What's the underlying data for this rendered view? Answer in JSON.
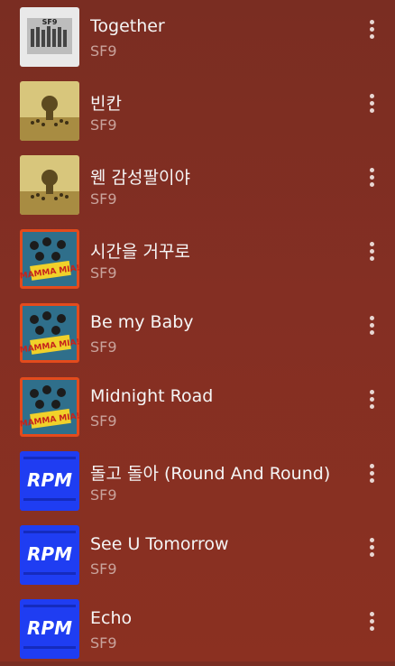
{
  "songs": [
    {
      "title": "Together",
      "artist": "SF9",
      "art": "album-sf9",
      "art_text": "SF9"
    },
    {
      "title": "빈칸",
      "artist": "SF9",
      "art": "album-gold",
      "art_text": ""
    },
    {
      "title": "웬 감성팔이야",
      "artist": "SF9",
      "art": "album-gold",
      "art_text": ""
    },
    {
      "title": "시간을 거꾸로",
      "artist": "SF9",
      "art": "album-mamma",
      "art_text": "MAMMA MIA!"
    },
    {
      "title": "Be my Baby",
      "artist": "SF9",
      "art": "album-mamma",
      "art_text": "MAMMA MIA!"
    },
    {
      "title": "Midnight Road",
      "artist": "SF9",
      "art": "album-mamma",
      "art_text": "MAMMA MIA!"
    },
    {
      "title": "돌고 돌아 (Round And Round)",
      "artist": "SF9",
      "art": "album-rpm",
      "art_text": "RPM"
    },
    {
      "title": "See U Tomorrow",
      "artist": "SF9",
      "art": "album-rpm",
      "art_text": "RPM"
    },
    {
      "title": "Echo",
      "artist": "SF9",
      "art": "album-rpm",
      "art_text": "RPM"
    }
  ],
  "colors": {
    "background_top": "#7a2d22",
    "background_bottom": "#8b3021",
    "title_text": "#f5f5f5",
    "artist_text": "#c9a39c",
    "rpm_blue": "#1f3df2",
    "mamma_orange": "#e44b1c",
    "gold_art": "#d9c27a"
  },
  "icons": {
    "more": "more-vertical-icon"
  }
}
